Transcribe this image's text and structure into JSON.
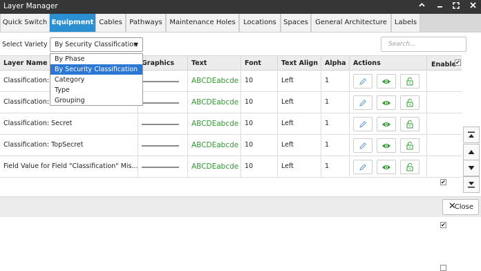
{
  "window": {
    "title": "Layer Manager"
  },
  "tabs": [
    {
      "label": "Quick Switch",
      "active": false
    },
    {
      "label": "Equipment",
      "active": true
    },
    {
      "label": "Cables",
      "active": false
    },
    {
      "label": "Pathways",
      "active": false
    },
    {
      "label": "Maintenance Holes",
      "active": false
    },
    {
      "label": "Locations",
      "active": false
    },
    {
      "label": "Spaces",
      "active": false
    },
    {
      "label": "General Architecture",
      "active": false
    },
    {
      "label": "Labels",
      "active": false
    }
  ],
  "toolbar": {
    "select_variety_label": "Select Variety",
    "selected_variety": "By Security Classification",
    "search_placeholder": "Search..."
  },
  "dropdown": {
    "options": [
      "By Phase",
      "By Security Classification",
      "Category",
      "Type",
      "Grouping"
    ],
    "selected_index": 1
  },
  "table": {
    "headers": {
      "layer_name": "Layer Name",
      "graphics": "Graphics",
      "text": "Text",
      "font_size": "Font Size",
      "text_align": "Text Align",
      "alpha": "Alpha",
      "actions": "Actions",
      "enable": "Enable"
    },
    "rows": [
      {
        "layer_name": "Classification: Unclassified",
        "text_sample": "ABCDEabcde",
        "font_size": "10",
        "text_align": "Left",
        "alpha": "1",
        "enabled": true
      },
      {
        "layer_name": "Classification: Sensitive",
        "text_sample": "ABCDEabcde",
        "font_size": "10",
        "text_align": "Left",
        "alpha": "1",
        "enabled": true
      },
      {
        "layer_name": "Classification: Secret",
        "text_sample": "ABCDEabcde",
        "font_size": "10",
        "text_align": "Left",
        "alpha": "1",
        "enabled": true
      },
      {
        "layer_name": "Classification: TopSecret",
        "text_sample": "ABCDEabcde",
        "font_size": "10",
        "text_align": "Left",
        "alpha": "1",
        "enabled": true
      },
      {
        "layer_name": "Field Value for Field \"Classification\" Mis...",
        "text_sample": "ABCDEabcde",
        "font_size": "10",
        "text_align": "Left",
        "alpha": "1",
        "enabled": false
      }
    ]
  },
  "footer": {
    "close_label": "Close"
  },
  "colors": {
    "titlebar": "#363636",
    "active_tab": "#2b90d2",
    "text_sample": "#2f9b2f",
    "edit_icon": "#5b9bd5",
    "eye_icon": "#2f9b2f",
    "lock_icon": "#2f9b2f"
  }
}
